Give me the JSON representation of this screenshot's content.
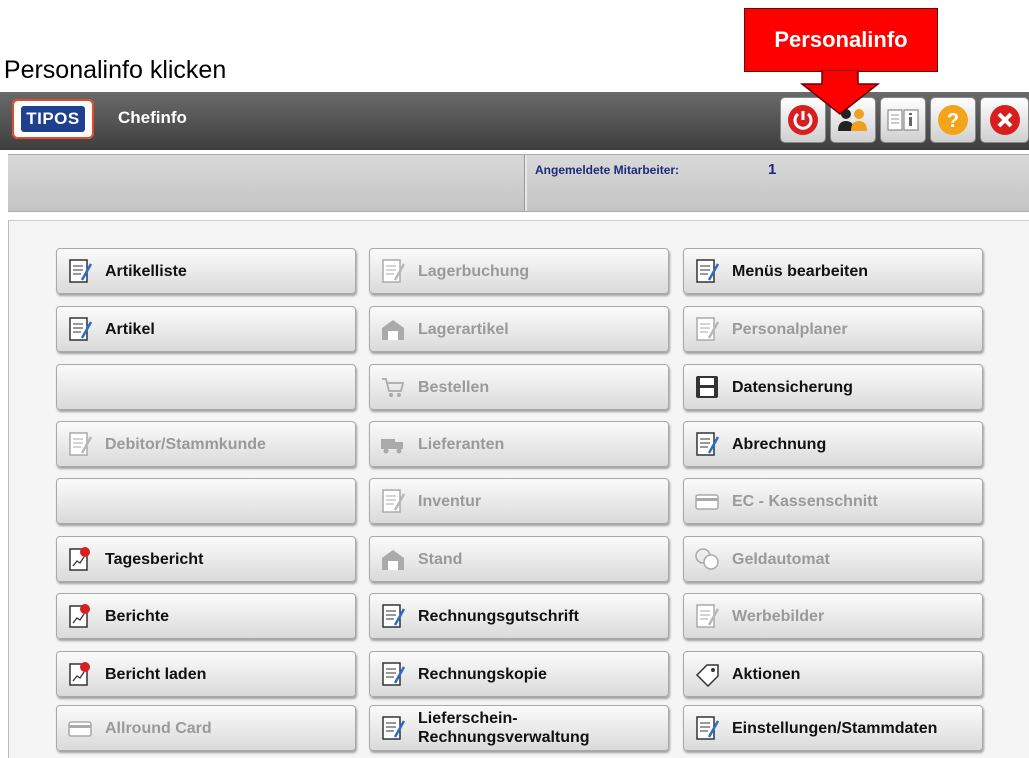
{
  "caption": "f Personalinfo klicken",
  "callout": {
    "label": "Personalinfo",
    "color": "#ff0000"
  },
  "titlebar": {
    "app_title": "Chefinfo",
    "logo_text": "TIPOS"
  },
  "toolbar_icons": [
    "power-icon",
    "staff-icon",
    "info-icon",
    "help-icon",
    "close-icon"
  ],
  "infobar": {
    "label": "Angemeldete Mitarbeiter:",
    "value": "1"
  },
  "columns": {
    "left": [
      {
        "label": "Artikelliste",
        "enabled": true,
        "icon": "list-edit-icon"
      },
      {
        "label": "Artikel",
        "enabled": true,
        "icon": "article-edit-icon"
      },
      {
        "label": "",
        "enabled": true,
        "icon": ""
      },
      {
        "label": "Debitor/Stammkunde",
        "enabled": false,
        "icon": "customer-edit-icon"
      },
      {
        "label": "",
        "enabled": true,
        "icon": ""
      },
      {
        "label": "Tagesbericht",
        "enabled": true,
        "icon": "daily-report-icon"
      },
      {
        "label": "Berichte",
        "enabled": true,
        "icon": "reports-icon"
      },
      {
        "label": "Bericht laden",
        "enabled": true,
        "icon": "load-report-icon"
      },
      {
        "label": "Allround Card",
        "enabled": false,
        "icon": "card-icon"
      }
    ],
    "middle": [
      {
        "label": "Lagerbuchung",
        "enabled": false,
        "icon": "stock-booking-icon"
      },
      {
        "label": "Lagerartikel",
        "enabled": false,
        "icon": "warehouse-article-icon"
      },
      {
        "label": "Bestellen",
        "enabled": false,
        "icon": "cart-order-icon"
      },
      {
        "label": "Lieferanten",
        "enabled": false,
        "icon": "truck-icon"
      },
      {
        "label": "Inventur",
        "enabled": false,
        "icon": "inventory-icon"
      },
      {
        "label": "Stand",
        "enabled": false,
        "icon": "stock-level-icon"
      },
      {
        "label": "Rechnungsgutschrift",
        "enabled": true,
        "icon": "credit-note-icon"
      },
      {
        "label": "Rechnungskopie",
        "enabled": true,
        "icon": "invoice-copy-icon"
      },
      {
        "label": "Lieferschein-",
        "label2": "Rechnungsverwaltung",
        "enabled": true,
        "icon": "delivery-note-icon"
      }
    ],
    "right": [
      {
        "label": "Menüs bearbeiten",
        "enabled": true,
        "icon": "menu-edit-icon"
      },
      {
        "label": "Personalplaner",
        "enabled": false,
        "icon": "staff-planner-icon"
      },
      {
        "label": "Datensicherung",
        "enabled": true,
        "icon": "save-disk-icon"
      },
      {
        "label": "Abrechnung",
        "enabled": true,
        "icon": "billing-icon"
      },
      {
        "label": "EC - Kassenschnitt",
        "enabled": false,
        "icon": "ec-card-icon"
      },
      {
        "label": "Geldautomat",
        "enabled": false,
        "icon": "coins-icon"
      },
      {
        "label": "Werbebilder",
        "enabled": false,
        "icon": "ad-images-icon"
      },
      {
        "label": "Aktionen",
        "enabled": true,
        "icon": "promotion-tag-icon"
      },
      {
        "label": "Einstellungen/Stammdaten",
        "enabled": true,
        "icon": "settings-doc-icon"
      }
    ]
  }
}
